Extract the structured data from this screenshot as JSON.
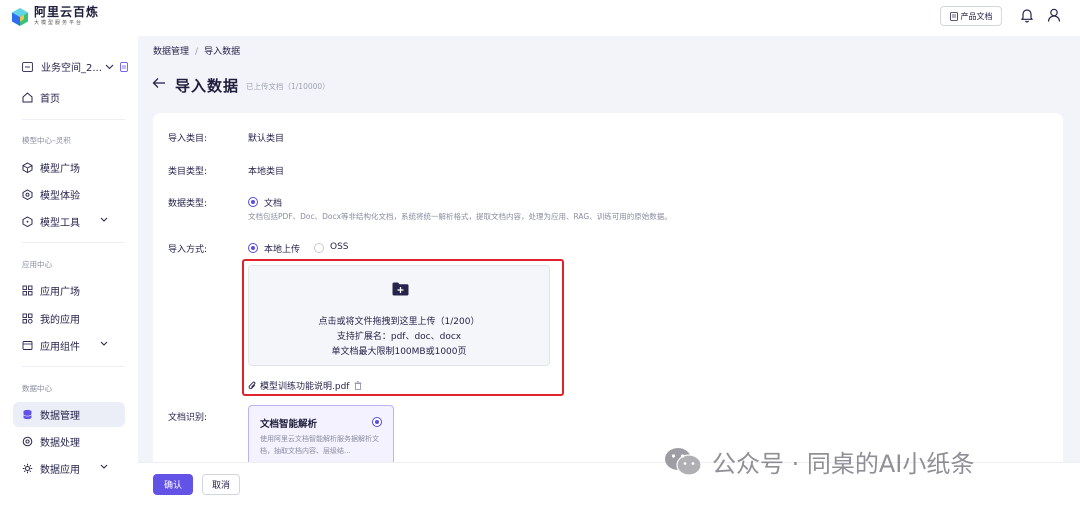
{
  "app": {
    "title": "阿里云百炼",
    "subtitle": "大模型服务平台"
  },
  "header": {
    "doc_button": "产品文档"
  },
  "sidebar": {
    "workspace": "业务空间_2...",
    "home": "首页",
    "groups": [
      {
        "title": "模型中心–灵积",
        "items": [
          "模型广场",
          "模型体验",
          "模型工具"
        ]
      },
      {
        "title": "应用中心",
        "items": [
          "应用广场",
          "我的应用",
          "应用组件"
        ]
      },
      {
        "title": "数据中心",
        "items": [
          "数据管理",
          "数据处理",
          "数据应用"
        ]
      }
    ]
  },
  "breadcrumb": [
    "数据管理",
    "导入数据"
  ],
  "page": {
    "title": "导入数据",
    "subtitle": "已上传文档（1/10000）"
  },
  "form": {
    "category": {
      "label": "导入类目:",
      "value": "默认类目"
    },
    "category_type": {
      "label": "类目类型:",
      "value": "本地类目"
    },
    "data_type": {
      "label": "数据类型:",
      "option": "文档",
      "description": "文档包括PDF、Doc、Docx等非结构化文档，系统将统一解析格式，提取文档内容，处理为应用、RAG、训练可用的原始数据。"
    },
    "import_method": {
      "label": "导入方式:",
      "options": [
        "本地上传",
        "OSS"
      ],
      "selected": "本地上传"
    },
    "upload": {
      "line1": "点击或将文件拖拽到这里上传（1/200）",
      "line2": "支持扩展名：pdf、doc、docx",
      "line3": "单文档最大限制100MB或1000页"
    },
    "file": {
      "name": "模型训练功能说明.pdf"
    },
    "recognition": {
      "label": "文档识别:",
      "card_title": "文档智能解析",
      "card_desc": "使用阿里云文档智能解析服务据解析文档，抽取文档内容、层级结..."
    }
  },
  "footer": {
    "confirm": "确认",
    "cancel": "取消"
  },
  "watermark": "公众号 · 同桌的AI小纸条",
  "colors": {
    "accent": "#6252e6",
    "highlight": "#e0222c",
    "bg": "#f3f4f9"
  }
}
